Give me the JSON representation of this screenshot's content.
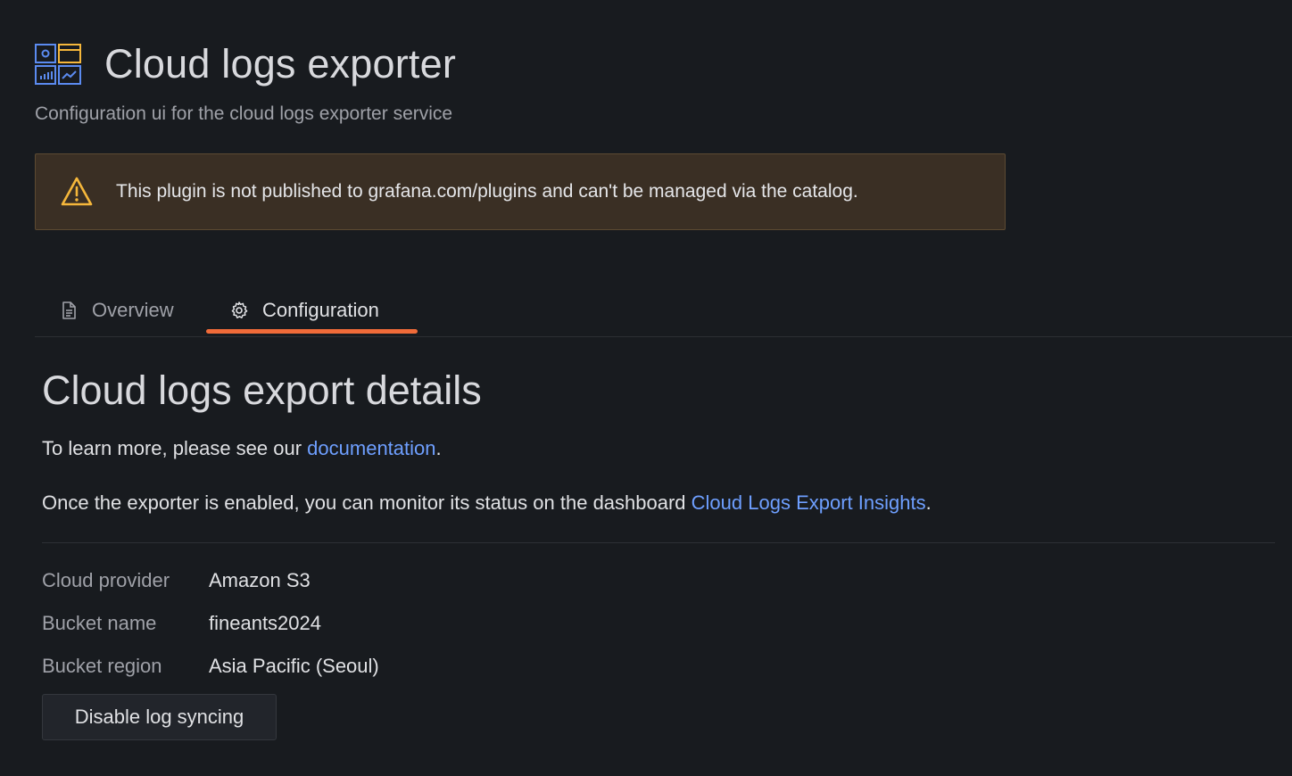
{
  "header": {
    "title": "Cloud logs exporter",
    "subtitle": "Configuration ui for the cloud logs exporter service",
    "logo_icon": "dashboard-grid-icon"
  },
  "alert": {
    "icon": "warning-triangle-icon",
    "text": "This plugin is not published to grafana.com/plugins and can't be managed via the catalog."
  },
  "tabs": [
    {
      "label": "Overview",
      "icon": "document-icon",
      "active": false
    },
    {
      "label": "Configuration",
      "icon": "gear-icon",
      "active": true
    }
  ],
  "section": {
    "title": "Cloud logs export details",
    "learn_more_prefix": "To learn more, please see our ",
    "learn_more_link": "documentation",
    "learn_more_suffix": ".",
    "monitor_prefix": "Once the exporter is enabled, you can monitor its status on the dashboard ",
    "monitor_link": "Cloud Logs Export Insights",
    "monitor_suffix": "."
  },
  "fields": [
    {
      "label": "Cloud provider",
      "value": "Amazon S3"
    },
    {
      "label": "Bucket name",
      "value": "fineants2024"
    },
    {
      "label": "Bucket region",
      "value": "Asia Pacific (Seoul)"
    }
  ],
  "actions": {
    "disable_label": "Disable log syncing"
  },
  "colors": {
    "background": "#181b1f",
    "accent_tab": "#f06b39",
    "link": "#6e9fff",
    "alert_bg": "#3a2f24",
    "warning": "#f5b73b"
  }
}
